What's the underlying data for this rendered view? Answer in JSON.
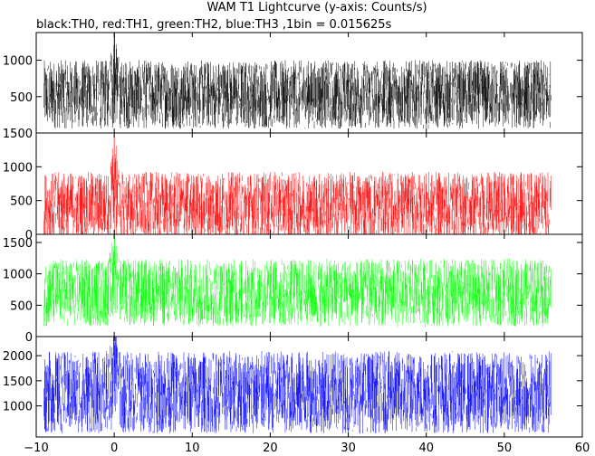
{
  "title": "WAM T1 Lightcurve (y-axis: Counts/s)",
  "subtitle": "black:TH0, red:TH1, green:TH2, blue:TH3 ,1bin = 0.015625s",
  "chart_data": {
    "type": "line",
    "title": "WAM T1 Lightcurve (y-axis: Counts/s)",
    "subtitle": "black:TH0, red:TH1, green:TH2, blue:TH3 ,1bin = 0.015625s",
    "xlabel": "",
    "ylabel": "",
    "x_range": [
      -9,
      56
    ],
    "bin_seconds": 0.015625,
    "xlim": [
      -10,
      60
    ],
    "x_ticks": [
      -10,
      0,
      10,
      20,
      30,
      40,
      50,
      60
    ],
    "x_tick_labels": [
      "−10",
      "0",
      "10",
      "20",
      "30",
      "40",
      "50",
      "60"
    ],
    "grid": false,
    "legend": "none (channel colors given in subtitle)",
    "panels": [
      {
        "name": "TH0",
        "color": "#000000",
        "ylim": [
          0,
          1380
        ],
        "y_ticks": [
          500,
          1000
        ],
        "y_tick_labels": [
          "500",
          "1000"
        ],
        "baseline_mean": 530,
        "noise_range": [
          150,
          1200
        ],
        "peak": {
          "x": 0,
          "y": 1340
        }
      },
      {
        "name": "TH1",
        "color": "#ff0000",
        "ylim": [
          0,
          1500
        ],
        "y_ticks": [
          0,
          500,
          1000,
          1500
        ],
        "y_tick_labels": [
          "0",
          "500",
          "1000",
          "1500"
        ],
        "baseline_mean": 420,
        "noise_range": [
          30,
          1150
        ],
        "peak": {
          "x": 0,
          "y": 1480
        }
      },
      {
        "name": "TH2",
        "color": "#00ff00",
        "ylim": [
          0,
          1630
        ],
        "y_ticks": [
          0,
          500,
          1000,
          1500
        ],
        "y_tick_labels": [
          "0",
          "500",
          "1000",
          "1500"
        ],
        "baseline_mean": 700,
        "noise_range": [
          150,
          1350
        ],
        "peak": {
          "x": 0,
          "y": 1620
        }
      },
      {
        "name": "TH3",
        "color": "#0000ff",
        "ylim": [
          380,
          2380
        ],
        "y_ticks": [
          1000,
          1500,
          2000
        ],
        "y_tick_labels": [
          "1000",
          "1500",
          "2000"
        ],
        "baseline_mean": 1270,
        "noise_range": [
          480,
          2300
        ],
        "peak": {
          "x": 0,
          "y": 2200
        }
      }
    ]
  }
}
